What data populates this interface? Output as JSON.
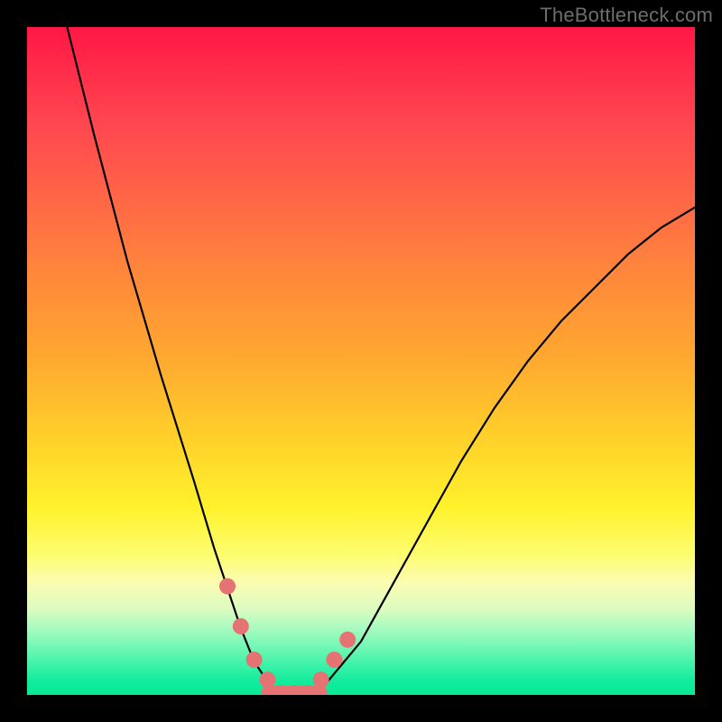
{
  "watermark": "TheBottleneck.com",
  "colors": {
    "marker": "#e57373",
    "curve": "#000000",
    "frame_bg_top": "#ff1744",
    "frame_bg_bottom": "#08e998",
    "page_bg": "#000000"
  },
  "chart_data": {
    "type": "line",
    "title": "",
    "xlabel": "",
    "ylabel": "",
    "xlim": [
      0,
      100
    ],
    "ylim": [
      0,
      100
    ],
    "grid": false,
    "series": [
      {
        "name": "bottleneck-curve",
        "x": [
          6,
          10,
          15,
          20,
          25,
          28,
          30,
          32,
          34,
          36,
          38,
          40,
          42,
          45,
          50,
          55,
          60,
          65,
          70,
          75,
          80,
          85,
          90,
          95,
          100
        ],
        "y": [
          100,
          84,
          65,
          48,
          32,
          22,
          16,
          10,
          5,
          2,
          0,
          0,
          0,
          2,
          8,
          17,
          26,
          35,
          43,
          50,
          56,
          61,
          66,
          70,
          73
        ]
      }
    ],
    "markers": {
      "name": "highlighted-points",
      "x": [
        30,
        32,
        34,
        36,
        38,
        40,
        42,
        44,
        46,
        48
      ],
      "y": [
        16,
        10,
        5,
        2,
        0,
        0,
        0,
        2,
        5,
        8
      ]
    },
    "floor_segment": {
      "x_start": 36,
      "x_end": 44,
      "y": 0
    }
  }
}
